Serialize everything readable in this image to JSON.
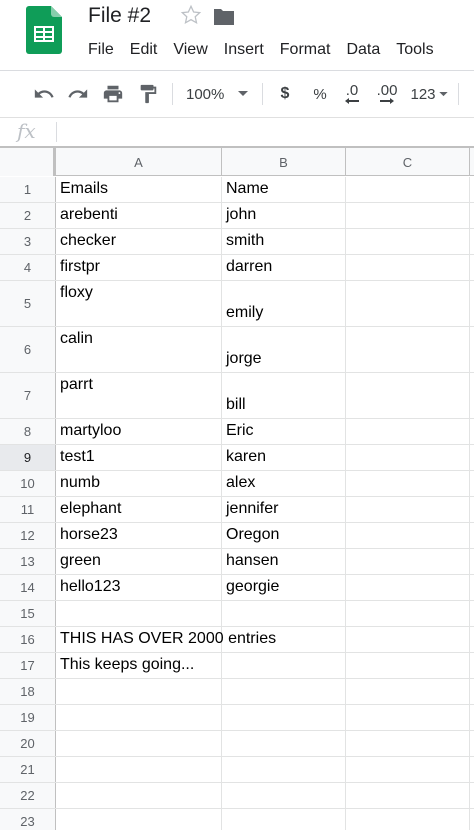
{
  "header": {
    "title": "File #2",
    "menu": [
      "File",
      "Edit",
      "View",
      "Insert",
      "Format",
      "Data",
      "Tools"
    ]
  },
  "toolbar": {
    "zoom": "100%",
    "currency_label": "$",
    "percent_label": "%",
    "dec_decrease_label": ".0",
    "dec_increase_label": ".00",
    "more_formats_label": "123"
  },
  "formula_bar": {
    "fx_label": "fx",
    "value": ""
  },
  "columns": [
    "A",
    "B",
    "C"
  ],
  "rows": [
    {
      "num": "1",
      "a": "Emails",
      "b": "Name"
    },
    {
      "num": "2",
      "a": "arebenti",
      "b": "john"
    },
    {
      "num": "3",
      "a": "checker",
      "b": "smith"
    },
    {
      "num": "4",
      "a": "firstpr",
      "b": "darren"
    },
    {
      "num": "5",
      "a": "floxy",
      "b": "emily"
    },
    {
      "num": "6",
      "a": "calin",
      "b": "jorge"
    },
    {
      "num": "7",
      "a": "parrt",
      "b": "bill"
    },
    {
      "num": "8",
      "a": "martyloo",
      "b": "Eric"
    },
    {
      "num": "9",
      "a": "test1",
      "b": "karen"
    },
    {
      "num": "10",
      "a": "numb",
      "b": "alex"
    },
    {
      "num": "11",
      "a": "elephant",
      "b": "jennifer"
    },
    {
      "num": "12",
      "a": "horse23",
      "b": "Oregon"
    },
    {
      "num": "13",
      "a": "green",
      "b": "hansen"
    },
    {
      "num": "14",
      "a": "hello123",
      "b": "georgie"
    },
    {
      "num": "15",
      "a": "",
      "b": ""
    },
    {
      "num": "16",
      "a": "THIS HAS OVER 2000 entries",
      "b": ""
    },
    {
      "num": "17",
      "a": "This keeps going...",
      "b": ""
    },
    {
      "num": "18",
      "a": "",
      "b": ""
    },
    {
      "num": "19",
      "a": "",
      "b": ""
    },
    {
      "num": "20",
      "a": "",
      "b": ""
    },
    {
      "num": "21",
      "a": "",
      "b": ""
    },
    {
      "num": "22",
      "a": "",
      "b": ""
    },
    {
      "num": "23",
      "a": "",
      "b": ""
    }
  ],
  "colors": {
    "sheets_green": "#0f9d58",
    "grid_line": "#e2e3e3",
    "header_bg": "#f8f9fa"
  }
}
